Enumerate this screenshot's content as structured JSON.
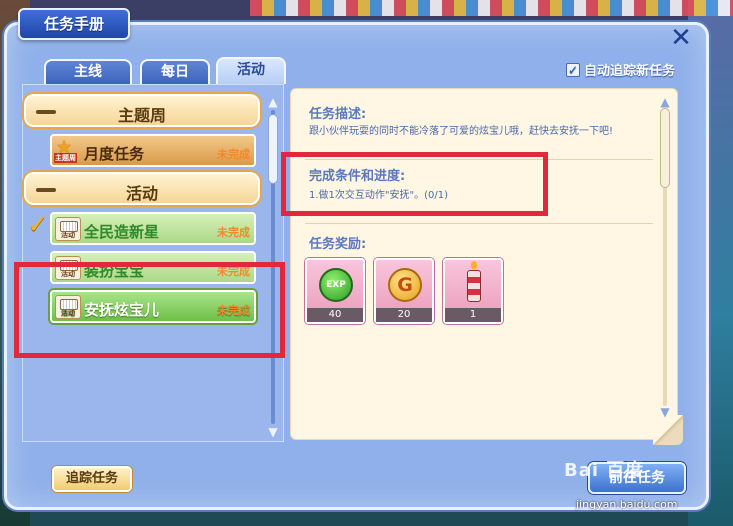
{
  "window": {
    "title": "任务手册"
  },
  "tabs": [
    {
      "label": "主线"
    },
    {
      "label": "每日"
    },
    {
      "label": "活动"
    }
  ],
  "auto_track": {
    "label": "自动追踪新任务",
    "checked": true
  },
  "task_list": {
    "categories": [
      {
        "label": "主题周"
      },
      {
        "label": "活动"
      }
    ],
    "items": [
      {
        "label": "月度任务",
        "status": "未完成",
        "badge": "主题周"
      },
      {
        "label": "全民造新星",
        "status": "未完成",
        "badge": "活动"
      },
      {
        "label": "装扮宝宝",
        "status": "未完成",
        "badge": "活动"
      },
      {
        "label": "安抚炫宝儿",
        "status": "未完成",
        "badge": "活动"
      }
    ]
  },
  "detail": {
    "description_title": "任务描述:",
    "description": "跟小伙伴玩耍的同时不能冷落了可爱的炫宝儿哦，赶快去安抚一下吧!",
    "condition_title": "完成条件和进度:",
    "condition": "1.做1次交互动作\"安抚\"。(0/1)",
    "reward_title": "任务奖励:",
    "rewards": [
      {
        "icon": "exp-icon",
        "label": "EXP",
        "count": "40"
      },
      {
        "icon": "gold-coin-icon",
        "label": "G",
        "count": "20"
      },
      {
        "icon": "candle-icon",
        "count": "1"
      }
    ]
  },
  "buttons": {
    "track": "追踪任务",
    "go": "前往任务"
  },
  "watermark": {
    "text": "Bai 百度",
    "url": "jingyan.baidu.com"
  },
  "colors": {
    "accent": "#3e72cc",
    "annotation": "#e2283c",
    "complete_status": "#f08a2a"
  }
}
